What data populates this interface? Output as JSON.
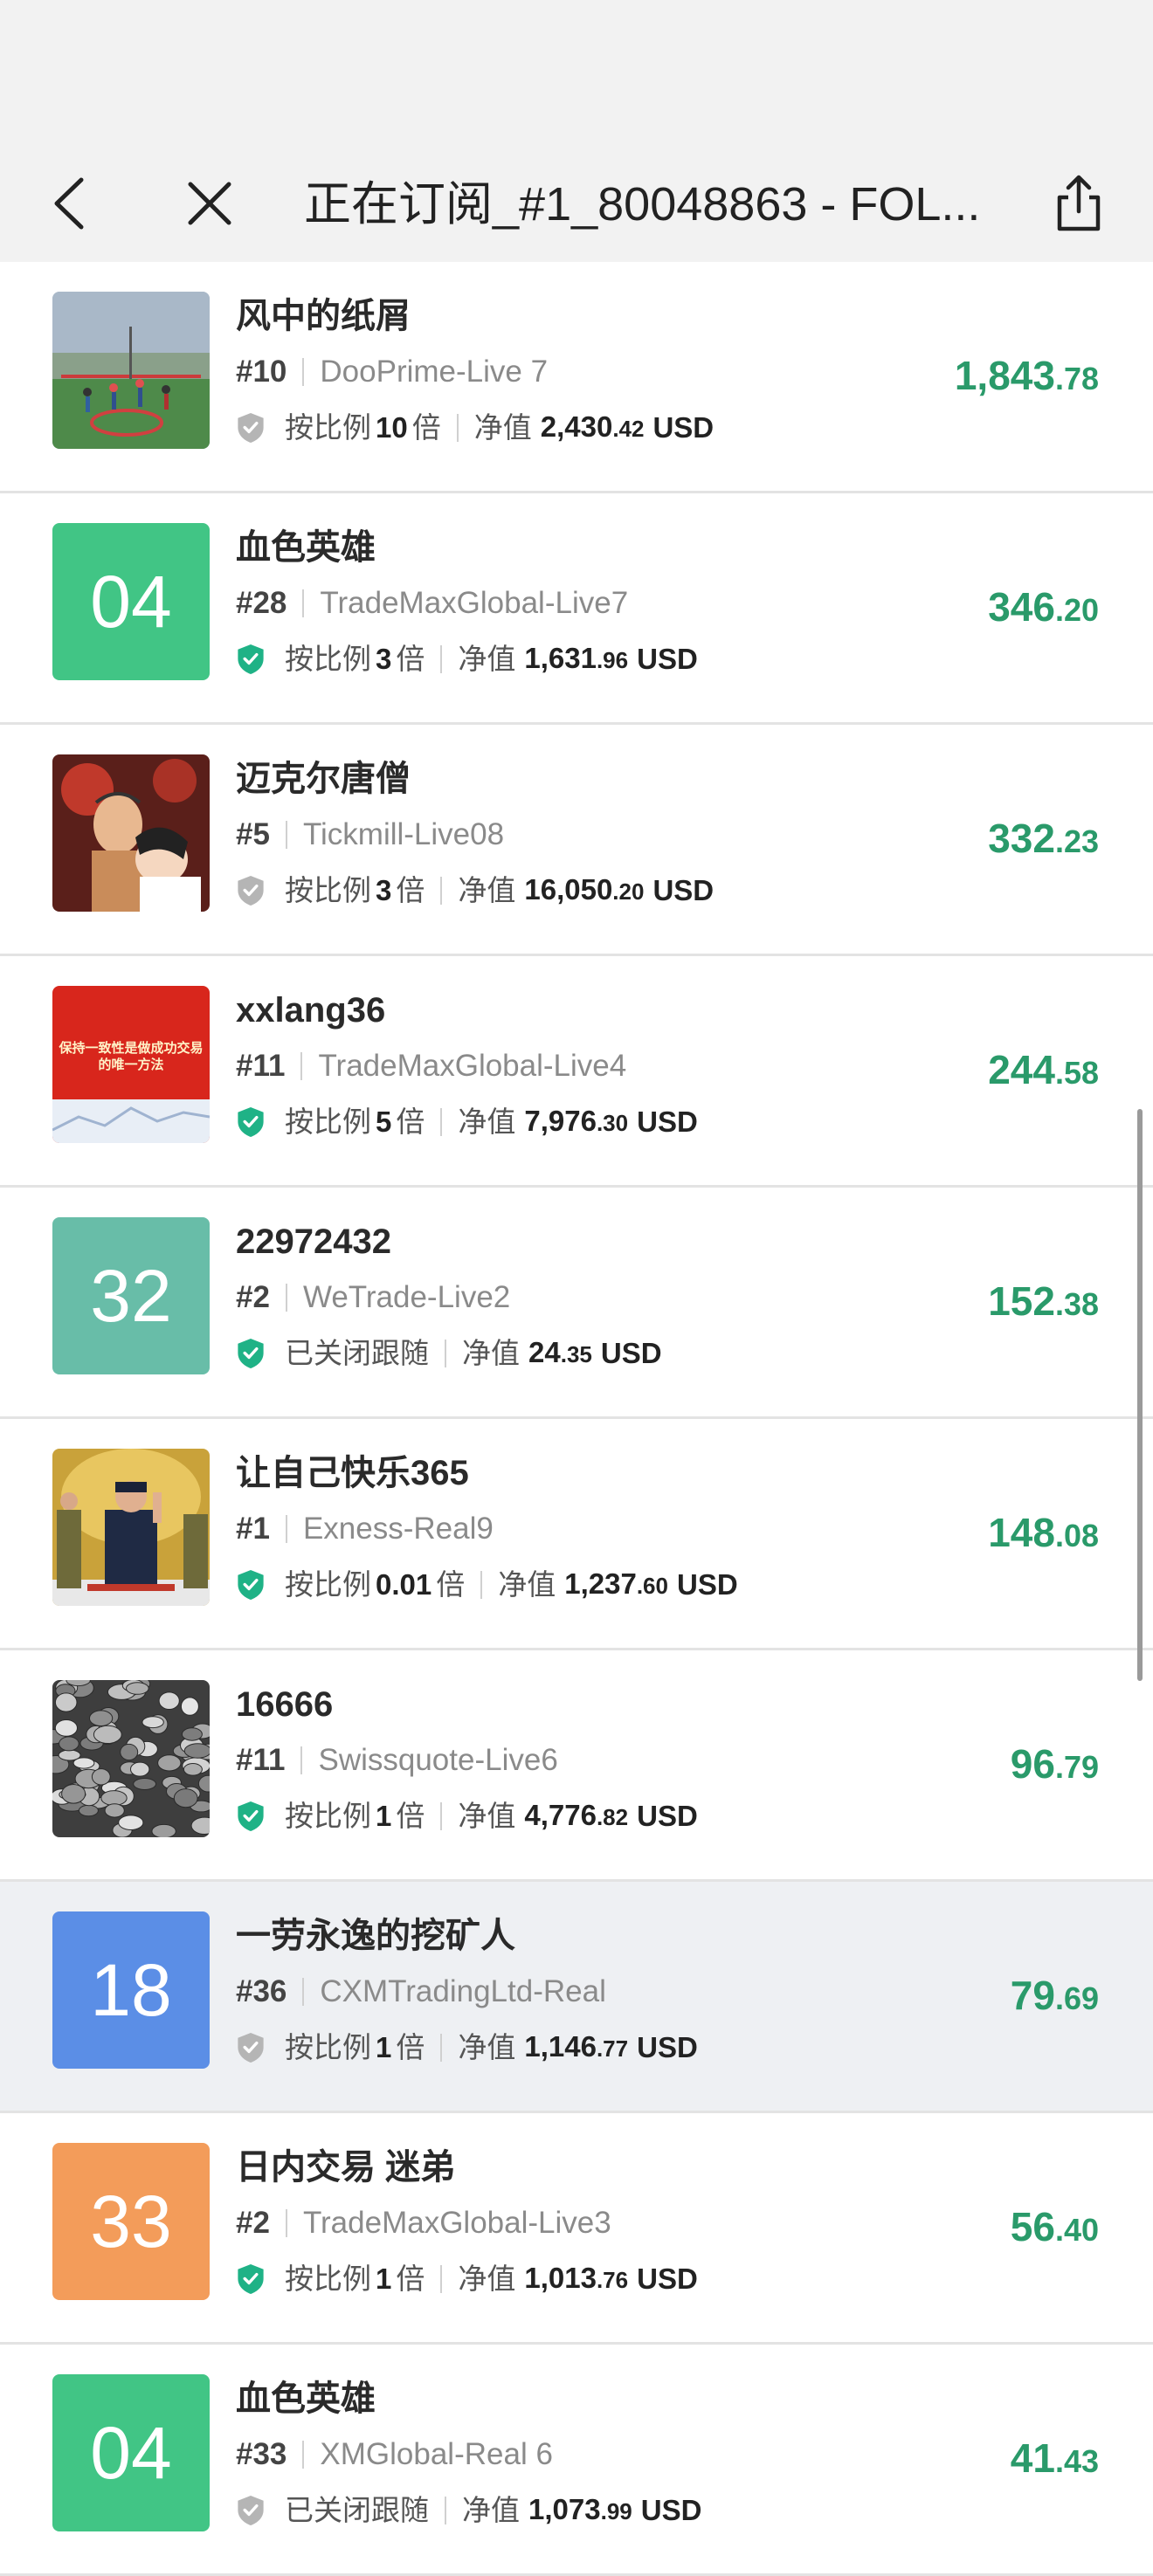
{
  "header": {
    "title": "正在订阅_#1_80048863 - FOL..."
  },
  "colors": {
    "profit": "#2a9a6a",
    "shield_active": "#1fb286",
    "shield_inactive": "#b5b5b5"
  },
  "rows": [
    {
      "name": "风中的纸屑",
      "rank": "#10",
      "server": "DooPrime-Live 7",
      "info": {
        "text": "按比例",
        "num": "10",
        "suffix": "倍"
      },
      "equity_label": "净值",
      "equity_int": "2,430",
      "equity_dec": ".42",
      "currency": "USD",
      "profit_int": "1,843",
      "profit_dec": ".78",
      "avatar": {
        "kind": "image",
        "subject": "basketball-court"
      },
      "shield": "inactive",
      "highlighted": false
    },
    {
      "name": "血色英雄",
      "rank": "#28",
      "server": "TradeMaxGlobal-Live7",
      "info": {
        "text": "按比例",
        "num": "3",
        "suffix": "倍"
      },
      "equity_label": "净值",
      "equity_int": "1,631",
      "equity_dec": ".96",
      "currency": "USD",
      "profit_int": "346",
      "profit_dec": ".20",
      "avatar": {
        "kind": "number",
        "text": "04",
        "color": "#41c585"
      },
      "shield": "active",
      "highlighted": false
    },
    {
      "name": "迈克尔唐僧",
      "rank": "#5",
      "server": "Tickmill-Live08",
      "info": {
        "text": "按比例",
        "num": "3",
        "suffix": "倍"
      },
      "equity_label": "净值",
      "equity_int": "16,050",
      "equity_dec": ".20",
      "currency": "USD",
      "profit_int": "332",
      "profit_dec": ".23",
      "avatar": {
        "kind": "image",
        "subject": "comic-illustration"
      },
      "shield": "inactive",
      "highlighted": false
    },
    {
      "name": "xxlang36",
      "rank": "#11",
      "server": "TradeMaxGlobal-Live4",
      "info": {
        "text": "按比例",
        "num": "5",
        "suffix": "倍"
      },
      "equity_label": "净值",
      "equity_int": "7,976",
      "equity_dec": ".30",
      "currency": "USD",
      "profit_int": "244",
      "profit_dec": ".58",
      "avatar": {
        "kind": "image",
        "subject": "red-banner",
        "caption_line1": "保持一致性是做成功交易",
        "caption_line2": "的唯一方法"
      },
      "shield": "active",
      "highlighted": false
    },
    {
      "name": "22972432",
      "rank": "#2",
      "server": "WeTrade-Live2",
      "info": {
        "text": "已关闭跟随",
        "num": "",
        "suffix": ""
      },
      "equity_label": "净值",
      "equity_int": "24",
      "equity_dec": ".35",
      "currency": "USD",
      "profit_int": "152",
      "profit_dec": ".38",
      "avatar": {
        "kind": "number",
        "text": "32",
        "color": "#68bda8"
      },
      "shield": "active",
      "highlighted": false
    },
    {
      "name": "让自己快乐365",
      "rank": "#1",
      "server": "Exness-Real9",
      "info": {
        "text": "按比例",
        "num": "0.01",
        "suffix": "倍"
      },
      "equity_label": "净值",
      "equity_int": "1,237",
      "equity_dec": ".60",
      "currency": "USD",
      "profit_int": "148",
      "profit_dec": ".08",
      "avatar": {
        "kind": "image",
        "subject": "ceremony-photo"
      },
      "shield": "active",
      "highlighted": false
    },
    {
      "name": "16666",
      "rank": "#11",
      "server": "Swissquote-Live6",
      "info": {
        "text": "按比例",
        "num": "1",
        "suffix": "倍"
      },
      "equity_label": "净值",
      "equity_int": "4,776",
      "equity_dec": ".82",
      "currency": "USD",
      "profit_int": "96",
      "profit_dec": ".79",
      "avatar": {
        "kind": "image",
        "subject": "coins-pile"
      },
      "shield": "active",
      "highlighted": false
    },
    {
      "name": "一劳永逸的挖矿人",
      "rank": "#36",
      "server": "CXMTradingLtd-Real",
      "info": {
        "text": "按比例",
        "num": "1",
        "suffix": "倍"
      },
      "equity_label": "净值",
      "equity_int": "1,146",
      "equity_dec": ".77",
      "currency": "USD",
      "profit_int": "79",
      "profit_dec": ".69",
      "avatar": {
        "kind": "number",
        "text": "18",
        "color": "#5b8ee6"
      },
      "shield": "inactive",
      "highlighted": true
    },
    {
      "name": "日内交易 迷弟",
      "rank": "#2",
      "server": "TradeMaxGlobal-Live3",
      "info": {
        "text": "按比例",
        "num": "1",
        "suffix": "倍"
      },
      "equity_label": "净值",
      "equity_int": "1,013",
      "equity_dec": ".76",
      "currency": "USD",
      "profit_int": "56",
      "profit_dec": ".40",
      "avatar": {
        "kind": "number",
        "text": "33",
        "color": "#f39c5a"
      },
      "shield": "active",
      "highlighted": false
    },
    {
      "name": "血色英雄",
      "rank": "#33",
      "server": "XMGlobal-Real 6",
      "info": {
        "text": "已关闭跟随",
        "num": "",
        "suffix": ""
      },
      "equity_label": "净值",
      "equity_int": "1,073",
      "equity_dec": ".99",
      "currency": "USD",
      "profit_int": "41",
      "profit_dec": ".43",
      "avatar": {
        "kind": "number",
        "text": "04",
        "color": "#41c585"
      },
      "shield": "inactive",
      "highlighted": false
    }
  ]
}
